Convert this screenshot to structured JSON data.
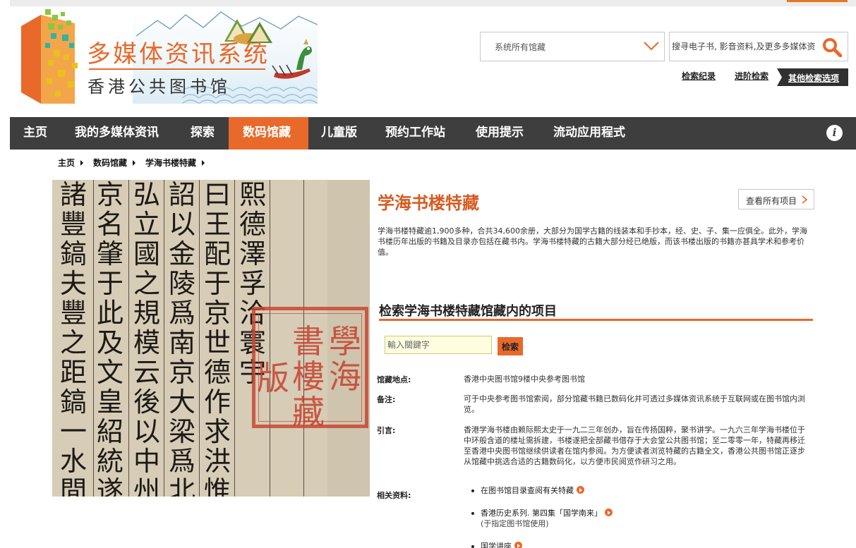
{
  "header": {
    "title": "多媒体资讯系统",
    "subtitle": "香港公共图书馆"
  },
  "search": {
    "scope": "系统所有馆藏",
    "placeholder": "搜寻电子书, 影音资料,及更多多媒体资",
    "history_link": "检索纪录",
    "advanced_link": "进阶检索",
    "other_options": "其他检索选项"
  },
  "nav": {
    "items": [
      {
        "label": "主页"
      },
      {
        "label": "我的多媒体资讯"
      },
      {
        "label": "探索"
      },
      {
        "label": "数码馆藏"
      },
      {
        "label": "儿童版"
      },
      {
        "label": "预约工作站"
      },
      {
        "label": "使用提示"
      },
      {
        "label": "流动应用程式"
      }
    ],
    "active": "数码馆藏"
  },
  "breadcrumb": [
    "主页",
    "数码馆藏",
    "学海书楼特藏"
  ],
  "collection": {
    "title": "学海书楼特藏",
    "view_all": "查看所有项目",
    "intro": "学海书楼特藏逾1,900多种，合共34,600余册，大部分为国学古籍的线装本和手抄本，经、史、子、集一应俱全。此外，学海书楼历年出版的书籍及目录亦包括在藏书内。学海书楼特藏的古籍大部分经已绝版，而该书楼出版的书籍亦甚具学术和参考价值。",
    "search_title": "检索学海书楼特藏馆藏内的项目",
    "keyword_placeholder": "輸入關鍵字",
    "search_button": "检索"
  },
  "details": {
    "location_label": "馆藏地点:",
    "location_value": "香港中央图书馆9楼中央参考图书馆",
    "notes_label": "备注:",
    "notes_value": "可于中央参考图书馆索阅，部分馆藏书籍已数码化并可透过多媒体资讯系统于互联网或在图书馆内浏览。",
    "intro_label": "引言:",
    "intro_value": "香港学海书楼由赖际熙太史于一九二三年创办，旨在传扬国粹，聚书讲学。一九六三年学海书楼位于中环般含道的楼址需拆建，书楼遂把全部藏书借存于大会堂公共图书馆；至二零零一年，特藏再移迁至香港中央图书馆继续供读者在馆内参阅。为方便读者浏览特藏的古籍全文，香港公共图书馆正逐步从馆藏中挑选合适的古籍数码化，以方便市民阅览作研习之用。",
    "related_label": "相关资料:",
    "related": [
      {
        "text": "在图书馆目录查阅有关特藏",
        "sub": ""
      },
      {
        "text": "香港历史系列. 第四集「国学南来」",
        "sub": "(于指定图书馆使用)"
      },
      {
        "text": "国学讲座",
        "sub": ""
      }
    ]
  },
  "manuscript": {
    "columns": [
      "熙德澤孚洽寰宇",
      "曰王配于京世德作求洪惟我",
      "詔以金陵爲南京大梁爲北京蓋",
      "弘立國之規模云後以中州凋",
      "京名肇于此及文皇紹統遂以北",
      "諸豐鎬夫豐之距鎬一水間爾故"
    ],
    "seal": [
      "學",
      "海",
      "書",
      "樓",
      "藏",
      "版"
    ]
  },
  "colors": {
    "accent": "#e8692a",
    "nav_bg": "#3e3e3e"
  }
}
